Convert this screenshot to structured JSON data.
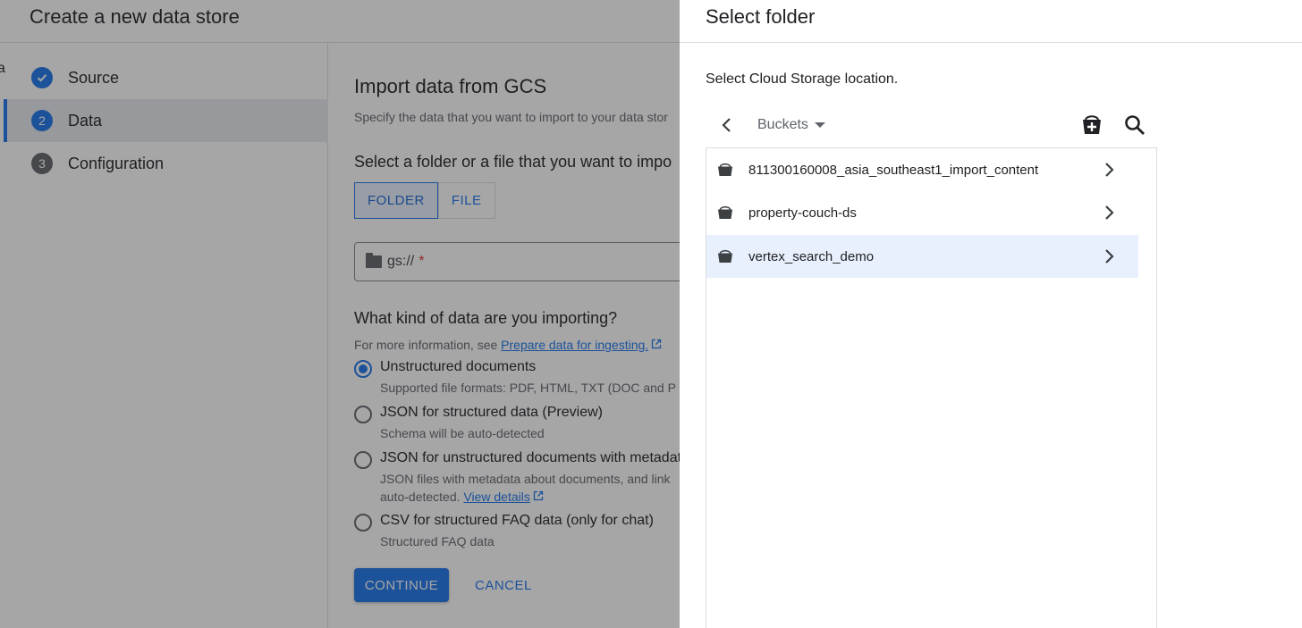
{
  "page": {
    "title": "Create a new data store",
    "edge_fragment": "a"
  },
  "steps": [
    {
      "num": "✓",
      "label": "Source",
      "state": "done"
    },
    {
      "num": "2",
      "label": "Data",
      "state": "active"
    },
    {
      "num": "3",
      "label": "Configuration",
      "state": "todo"
    }
  ],
  "import": {
    "heading": "Import data from GCS",
    "subtitle": "Specify the data that you want to import to your data stor",
    "select_heading": "Select a folder or a file that you want to impo",
    "toggle": {
      "folder": "FOLDER",
      "file": "FILE",
      "selected": "FOLDER"
    },
    "gs_field": {
      "prefix": "gs://",
      "required_mark": "*"
    },
    "kind_heading": "What kind of data are you importing?",
    "info_prefix": "For more information, see ",
    "info_link": "Prepare data for ingesting.",
    "options": [
      {
        "label": "Unstructured documents",
        "sub": "Supported file formats: PDF, HTML, TXT (DOC and P",
        "selected": true
      },
      {
        "label": "JSON for structured data (Preview)",
        "sub": "Schema will be auto-detected",
        "selected": false
      },
      {
        "label": "JSON for unstructured documents with metadat",
        "sub": "JSON files with metadata about documents, and link",
        "sub2": "auto-detected.",
        "sub2_link": "View details",
        "selected": false
      },
      {
        "label": "CSV for structured FAQ data (only for chat)",
        "sub": "Structured FAQ data",
        "selected": false
      }
    ],
    "continue_label": "CONTINUE",
    "cancel_label": "CANCEL"
  },
  "panel": {
    "title": "Select folder",
    "description": "Select Cloud Storage location.",
    "breadcrumb": "Buckets",
    "buckets": [
      {
        "name": "811300160008_asia_southeast1_import_content",
        "highlighted": false
      },
      {
        "name": "property-couch-ds",
        "highlighted": false
      },
      {
        "name": "vertex_search_demo",
        "highlighted": true
      }
    ]
  },
  "colors": {
    "accent": "#1a73e8",
    "highlight": "#e8f0fe",
    "scrim": "rgba(32,33,36,0.40)"
  },
  "icons": {
    "step_done": "check-circle-icon",
    "folder": "folder-icon",
    "external": "open-in-new-icon",
    "back": "chevron-left-icon",
    "caret": "caret-down-icon",
    "add_bucket": "add-bucket-icon",
    "search": "search-icon",
    "bucket": "bucket-icon",
    "row_chevron": "chevron-right-icon"
  }
}
